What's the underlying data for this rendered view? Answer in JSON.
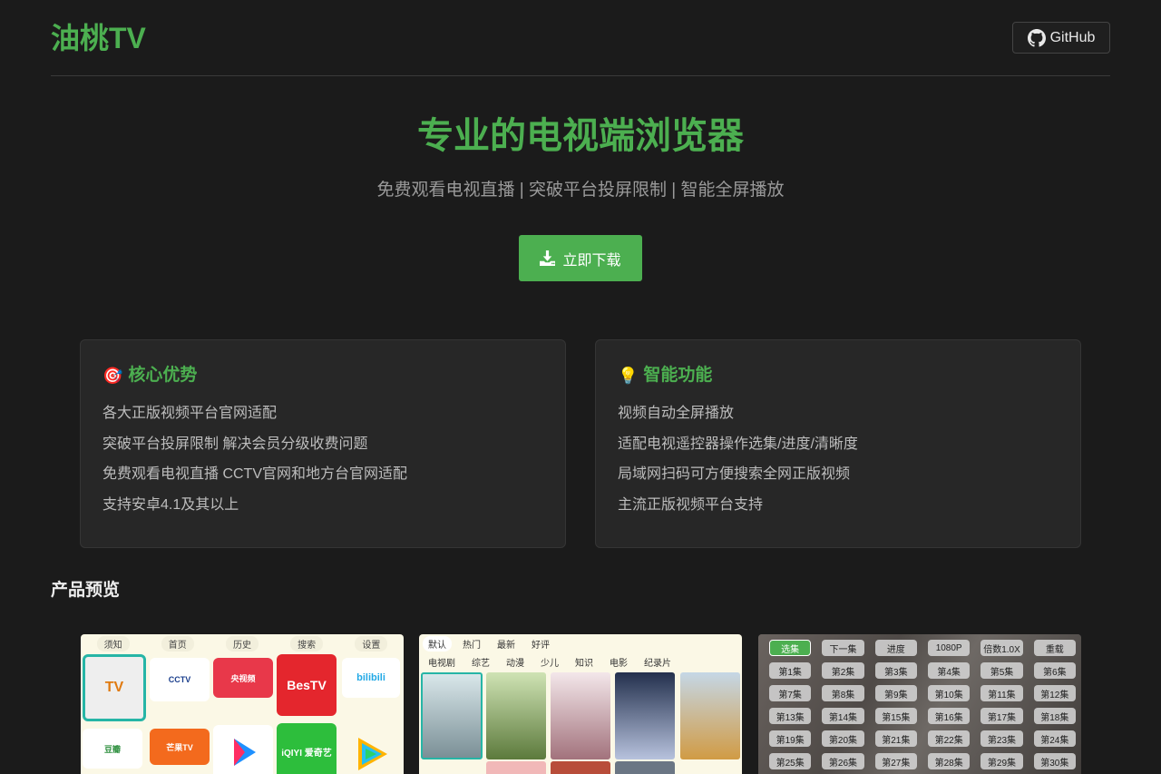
{
  "header": {
    "logo": "油桃TV",
    "github_label": "GitHub"
  },
  "hero": {
    "title": "专业的电视端浏览器",
    "subtitle": "免费观看电视直播 | 突破平台投屏限制 | 智能全屏播放",
    "download_label": "立即下载"
  },
  "features": [
    {
      "emoji": "🎯",
      "title": "核心优势",
      "items": [
        "各大正版视频平台官网适配",
        "突破平台投屏限制 解决会员分级收费问题",
        "免费观看电视直播 CCTV官网和地方台官网适配",
        "支持安卓4.1及其以上"
      ]
    },
    {
      "emoji": "💡",
      "title": "智能功能",
      "items": [
        "视频自动全屏播放",
        "适配电视遥控器操作选集/进度/清晰度",
        "局域网扫码可方便搜索全网正版视频",
        "主流正版视频平台支持"
      ]
    }
  ],
  "preview": {
    "title": "产品预览",
    "shot1": {
      "nav": [
        "须知",
        "首页",
        "历史",
        "搜索",
        "设置"
      ],
      "tiles": [
        "TV",
        "CCTV",
        "央视频",
        "BesTV",
        "bilibili",
        "豆瓣",
        "芒果TV",
        "",
        "iQIYI 爱奇艺",
        ""
      ]
    },
    "shot2": {
      "sort_tabs": [
        "默认",
        "热门",
        "最新",
        "好评"
      ],
      "category_tabs": [
        "电视剧",
        "综艺",
        "动漫",
        "少儿",
        "知识",
        "电影",
        "纪录片"
      ]
    },
    "shot3": {
      "controls": [
        "选集",
        "下一集",
        "进度",
        "1080P",
        "倍数1.0X",
        "重载"
      ],
      "episodes": [
        "第1集",
        "第2集",
        "第3集",
        "第4集",
        "第5集",
        "第6集",
        "第7集",
        "第8集",
        "第9集",
        "第10集",
        "第11集",
        "第12集",
        "第13集",
        "第14集",
        "第15集",
        "第16集",
        "第17集",
        "第18集",
        "第19集",
        "第20集",
        "第21集",
        "第22集",
        "第23集",
        "第24集",
        "第25集",
        "第26集",
        "第27集",
        "第28集",
        "第29集",
        "第30集"
      ]
    }
  }
}
